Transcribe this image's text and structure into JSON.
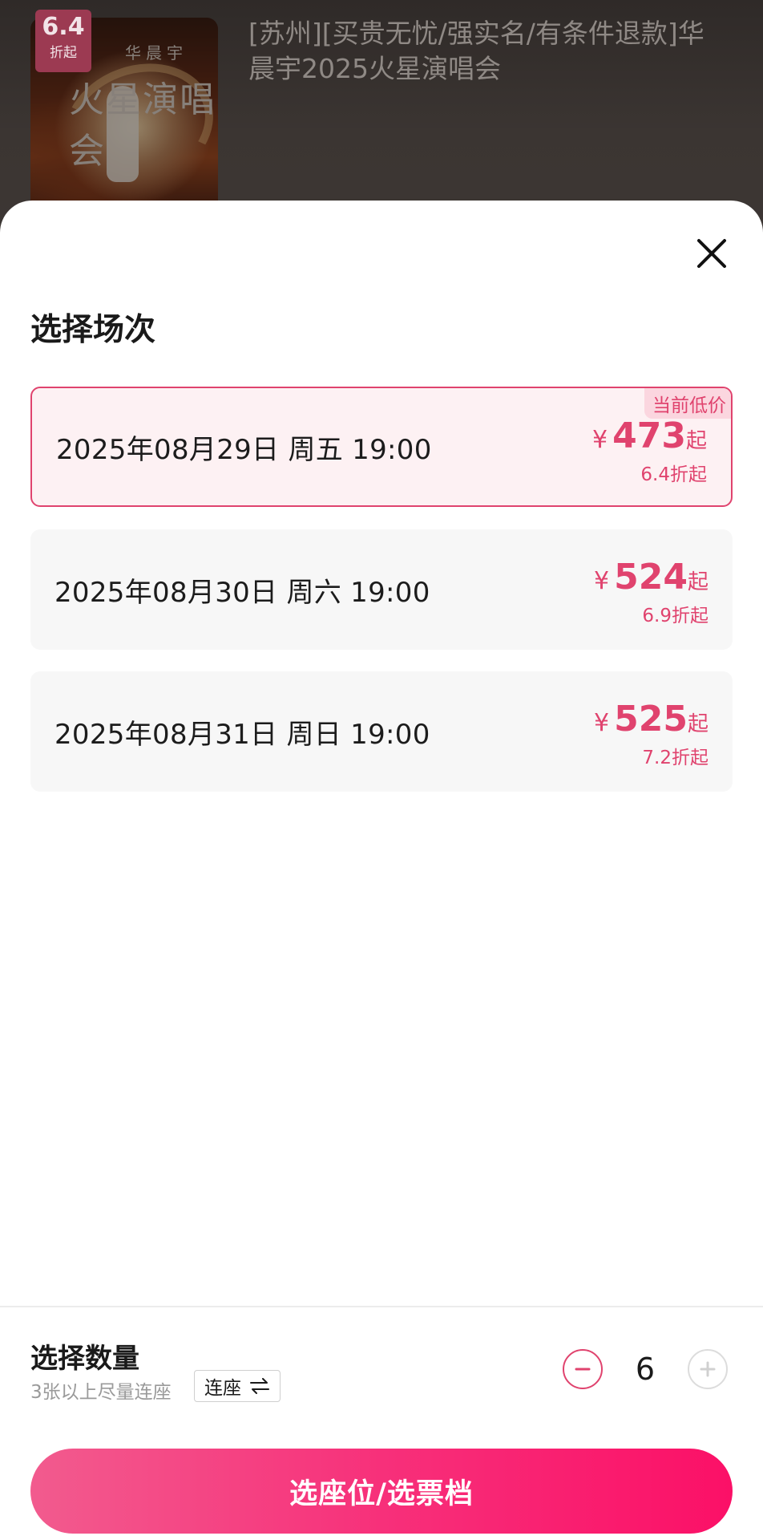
{
  "header": {
    "badge_num": "6.4",
    "badge_sub": "折起",
    "poster_artist": "华晨宇",
    "poster_title": "火星演唱会",
    "event_title": "[苏州][买贵无忧/强实名/有条件退款]华晨宇2025火星演唱会"
  },
  "sheet": {
    "title": "选择场次",
    "close_icon": "close-icon",
    "sessions": [
      {
        "date": "2025年08月29日 周五 19:00",
        "yen": "¥",
        "price": "473",
        "qi": "起",
        "discount": "6.4折起",
        "badge": "当前低价",
        "selected": true
      },
      {
        "date": "2025年08月30日 周六 19:00",
        "yen": "¥",
        "price": "524",
        "qi": "起",
        "discount": "6.9折起",
        "selected": false
      },
      {
        "date": "2025年08月31日 周日 19:00",
        "yen": "¥",
        "price": "525",
        "qi": "起",
        "discount": "7.2折起",
        "selected": false
      }
    ]
  },
  "quantity": {
    "title": "选择数量",
    "hint": "3张以上尽量连座",
    "seat_toggle_label": "连座",
    "value": "6"
  },
  "action": {
    "label": "选座位/选票档"
  },
  "colors": {
    "accent": "#e0436e",
    "button_start": "#f25b8e",
    "button_end": "#fb1067"
  }
}
